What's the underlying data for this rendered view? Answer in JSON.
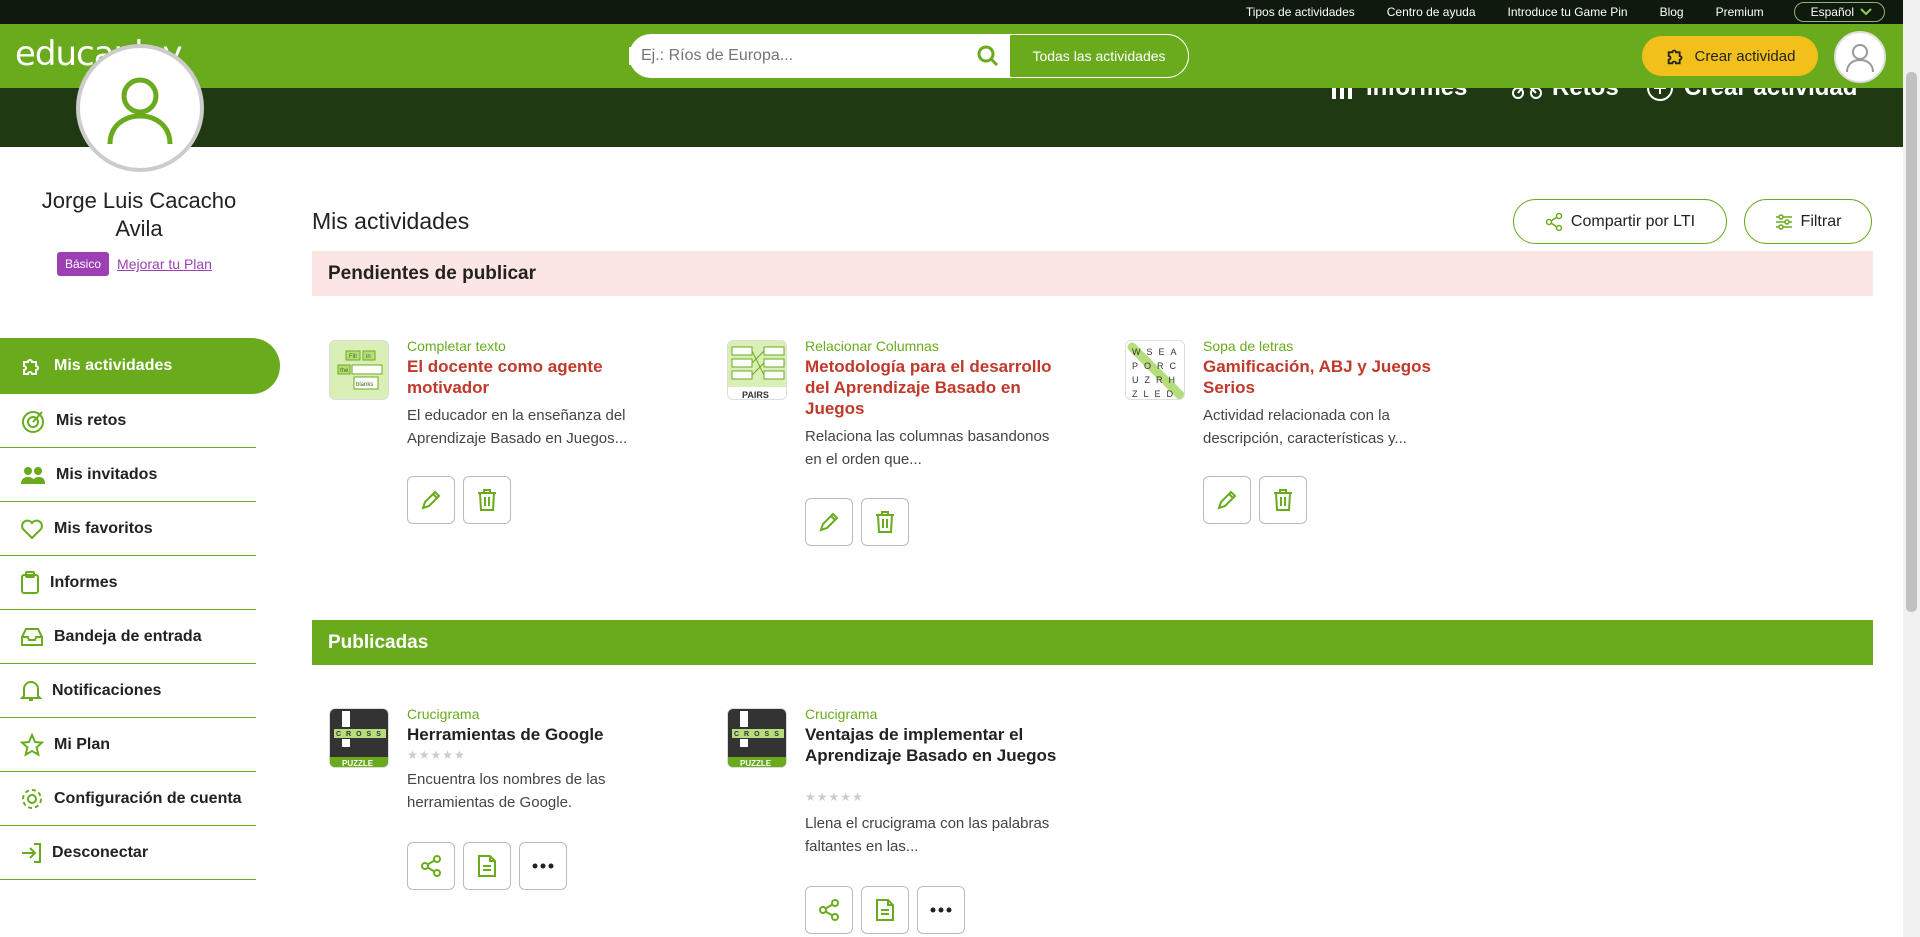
{
  "topnav": [
    "Tipos de actividades",
    "Centro de ayuda",
    "Introduce tu Game Pin",
    "Blog",
    "Premium"
  ],
  "language": "Español",
  "logo": "educaplay",
  "search": {
    "placeholder": "Ej.: Ríos de Europa...",
    "filter": "Todas las actividades"
  },
  "create_button": "Crear actividad",
  "banner_nav": [
    "Informes",
    "Retos",
    "Crear actividad"
  ],
  "profile": {
    "name": "Jorge Luis Cacacho Avila",
    "plan_badge": "Básico",
    "upgrade_link": "Mejorar tu Plan"
  },
  "sidebar": [
    {
      "label": "Mis actividades",
      "icon": "puzzle-icon"
    },
    {
      "label": "Mis retos",
      "icon": "target-icon"
    },
    {
      "label": "Mis invitados",
      "icon": "users-icon"
    },
    {
      "label": "Mis favoritos",
      "icon": "heart-icon"
    },
    {
      "label": "Informes",
      "icon": "clipboard-icon"
    },
    {
      "label": "Bandeja de entrada",
      "icon": "inbox-icon"
    },
    {
      "label": "Notificaciones",
      "icon": "bell-icon"
    },
    {
      "label": "Mi Plan",
      "icon": "star-icon"
    },
    {
      "label": "Configuración de cuenta",
      "icon": "gear-icon"
    },
    {
      "label": "Desconectar",
      "icon": "logout-icon"
    }
  ],
  "main": {
    "title": "Mis actividades",
    "share_lti": "Compartir por LTI",
    "filter": "Filtrar",
    "pending_title": "Pendientes de publicar",
    "published_title": "Publicadas",
    "pending": [
      {
        "type": "Completar texto",
        "title": "El docente como agente motivador",
        "desc": "El educador en la enseñanza del Aprendizaje Basado en Juegos..."
      },
      {
        "type": "Relacionar Columnas",
        "title": "Metodología para el desarrollo del Aprendizaje Basado en Juegos",
        "desc": "Relaciona las columnas basandonos en el orden que..."
      },
      {
        "type": "Sopa de letras",
        "title": "Gamificación, ABJ y Juegos Serios",
        "desc": "Actividad relacionada con la descripción, características y..."
      }
    ],
    "published": [
      {
        "type": "Crucigrama",
        "title": "Herramientas de Google",
        "desc": "Encuentra los nombres de las herramientas de Google."
      },
      {
        "type": "Crucigrama",
        "title": "Ventajas de implementar el Aprendizaje Basado en Juegos",
        "desc": "Llena el crucigrama con las palabras faltantes en las..."
      }
    ],
    "thumb_text": {
      "pairs": "PAIRS",
      "puzzle": "PUZZLE",
      "blanks": "blanks",
      "fill": "Fill",
      "in": "in",
      "the": "the",
      "cross": "CROSS",
      "wordsearch": [
        "WSEA",
        "PORC",
        "UZRH",
        "ZLED"
      ]
    }
  }
}
